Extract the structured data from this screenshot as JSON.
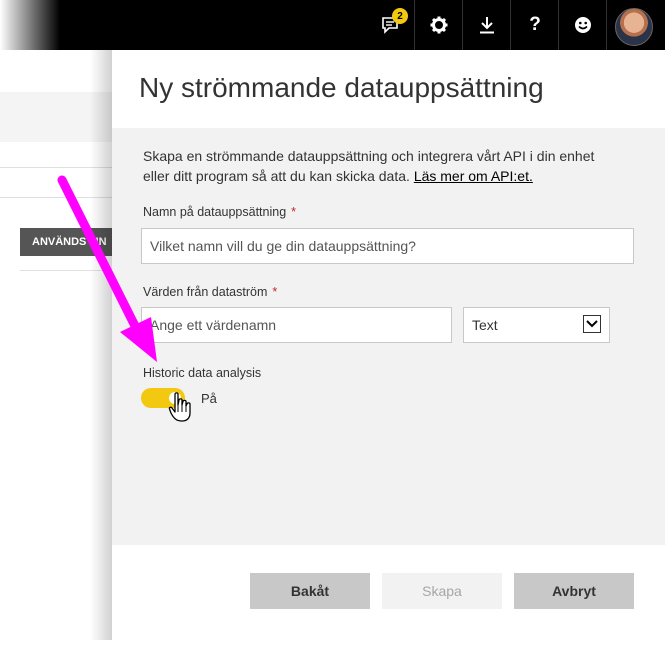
{
  "topbar": {
    "notification_count": "2",
    "icons": [
      "notification-icon",
      "gear-icon",
      "download-icon",
      "help-icon",
      "smiley-icon"
    ]
  },
  "background": {
    "column_header": "ANVÄNDS I IN"
  },
  "dialog": {
    "title": "Ny strömmande datauppsättning",
    "description": "Skapa en strömmande datauppsättning och integrera vårt API i din enhet eller ditt program så att du kan skicka data.",
    "learn_more": "Läs mer om API:et.",
    "dataset_name_label": "Namn på datauppsättning",
    "dataset_name_placeholder": "Vilket namn vill du ge din datauppsättning?",
    "stream_values_label": "Värden från dataström",
    "value_name_placeholder": "Ange ett värdenamn",
    "type_selected": "Text",
    "required_marker": "*",
    "historic_label": "Historic data analysis",
    "historic_state": "På",
    "historic_on": true,
    "back_button": "Bakåt",
    "create_button": "Skapa",
    "cancel_button": "Avbryt"
  },
  "colors": {
    "accent": "#f2c811",
    "annotation_arrow": "#ff00ff",
    "required": "#c4262e"
  }
}
